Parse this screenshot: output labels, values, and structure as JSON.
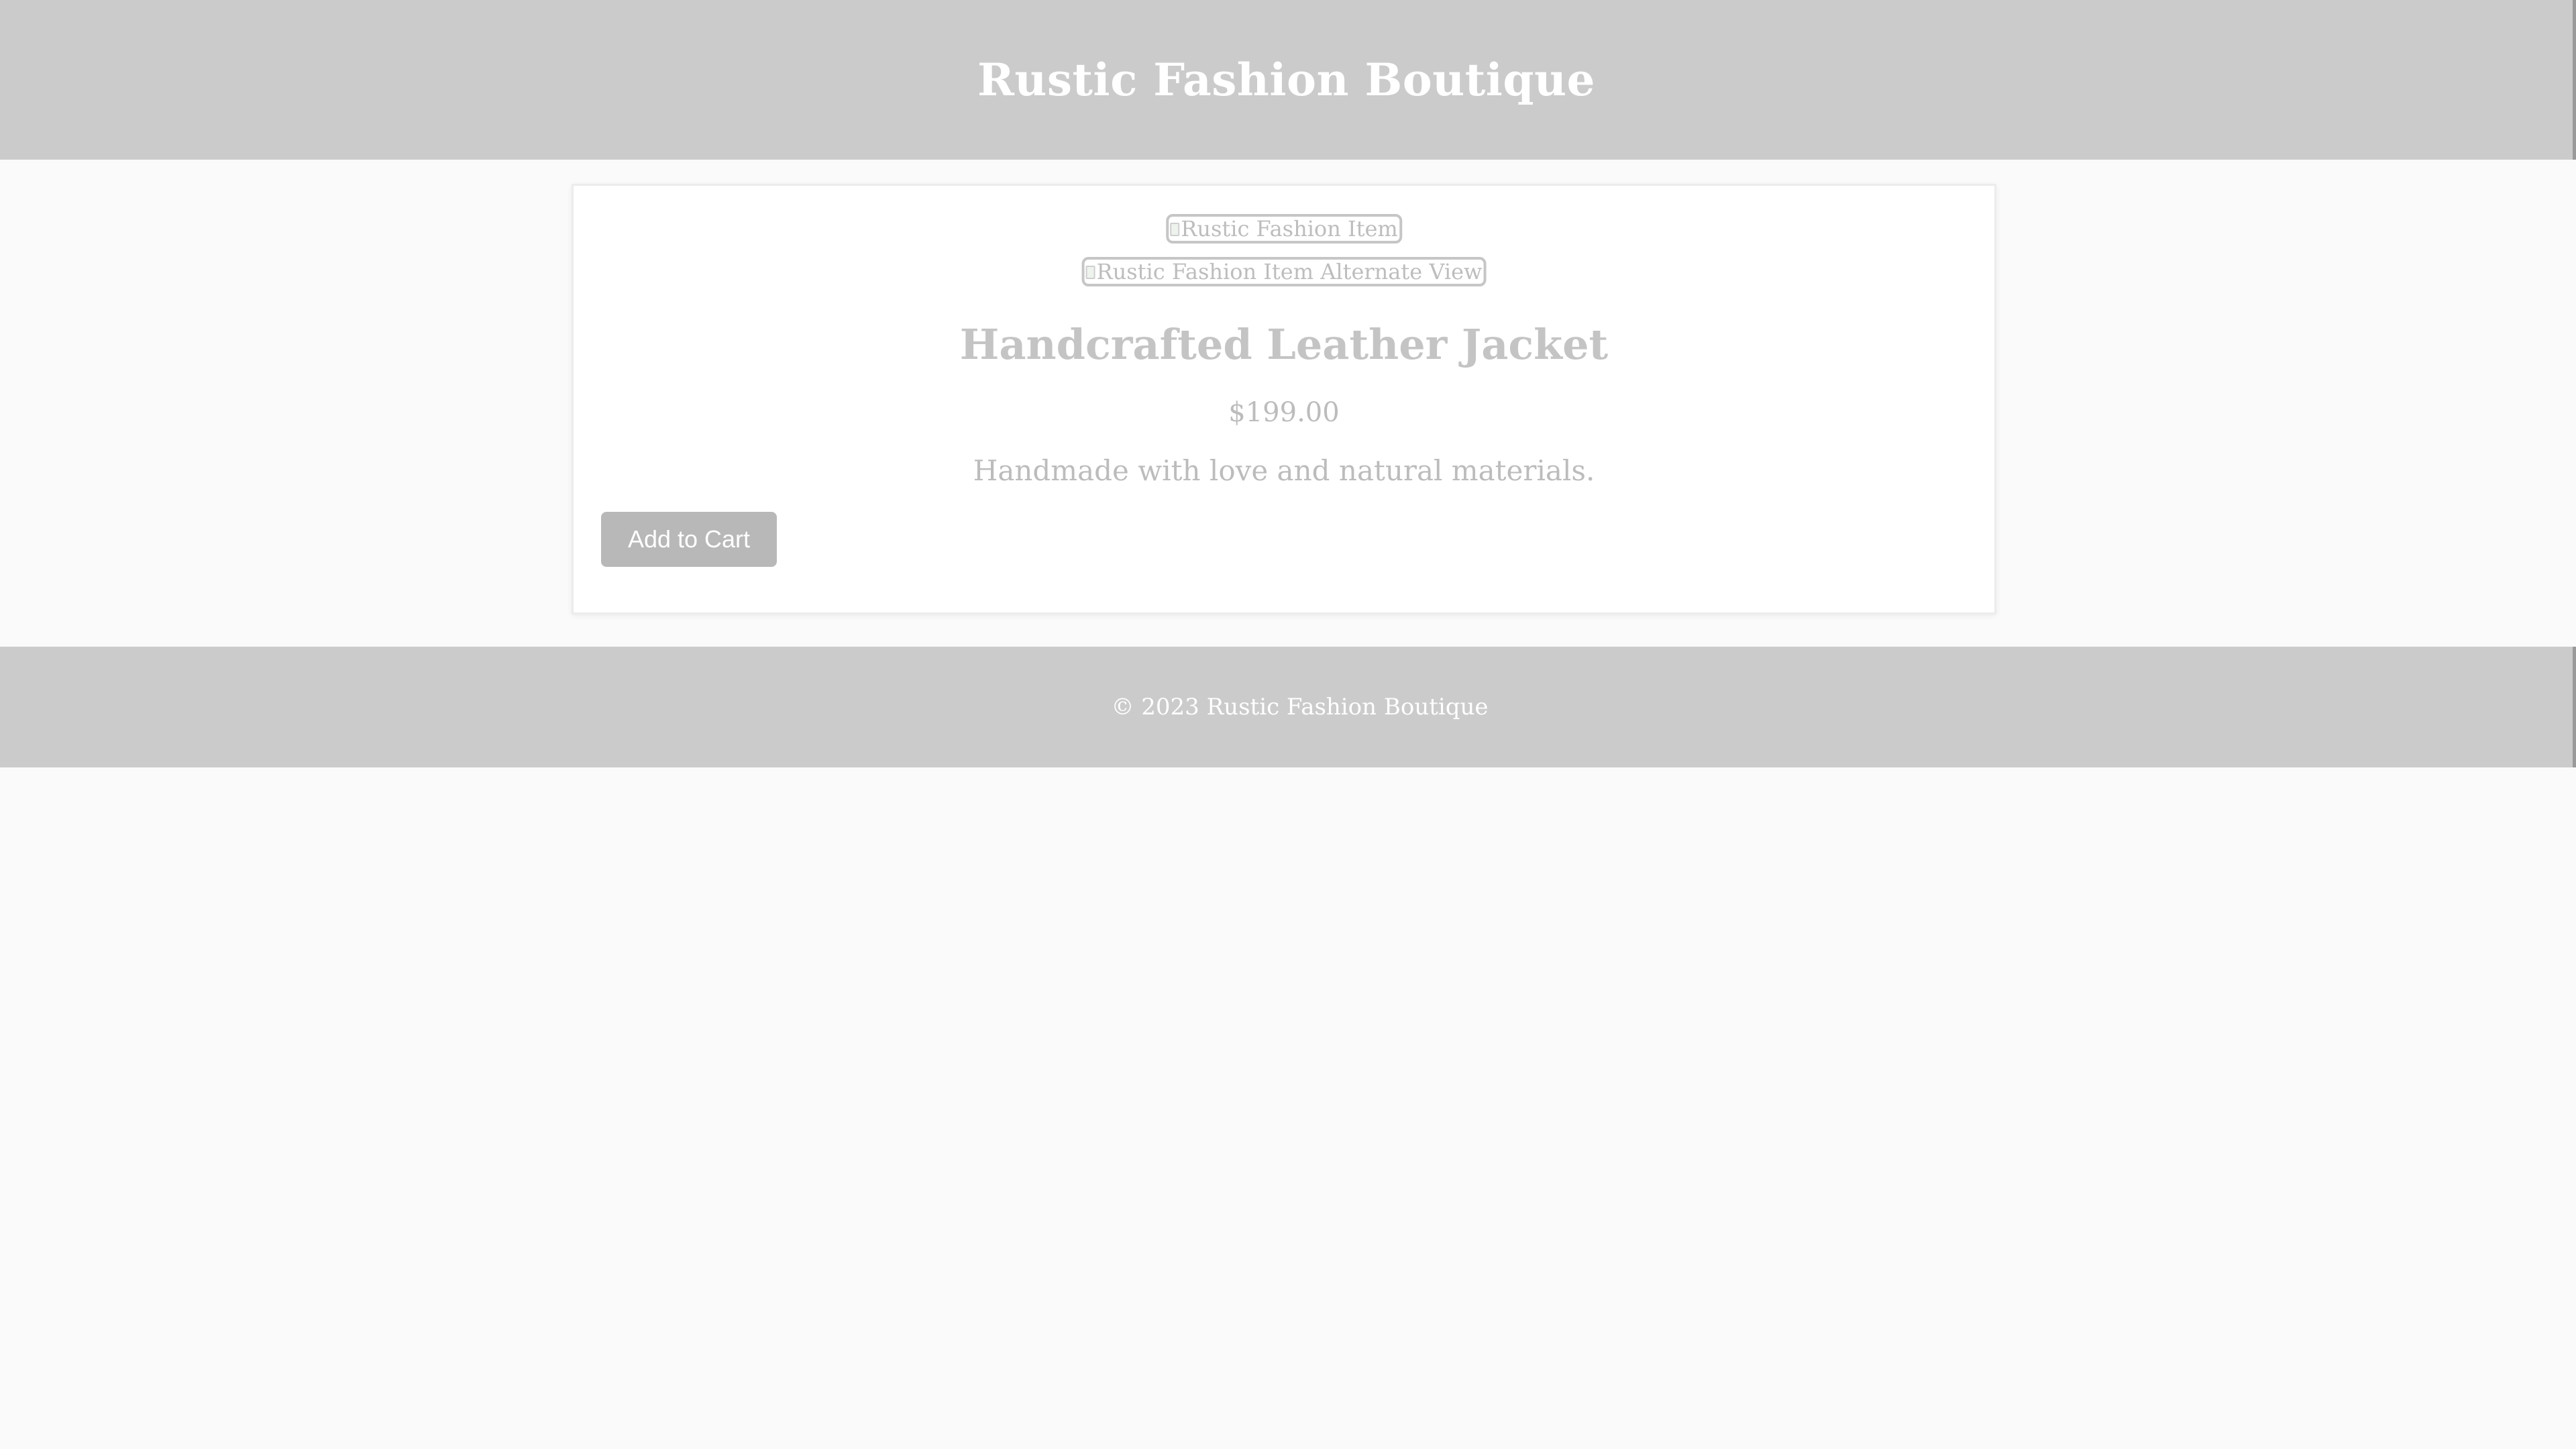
{
  "header": {
    "title": "Rustic Fashion Boutique"
  },
  "product": {
    "images": [
      {
        "alt": "Rustic Fashion Item",
        "icon": "broken-image-icon"
      },
      {
        "alt": "Rustic Fashion Item Alternate View",
        "icon": "broken-image-icon"
      }
    ],
    "title": "Handcrafted Leather Jacket",
    "price": "$199.00",
    "description": "Handmade with love and natural materials.",
    "add_to_cart_label": "Add to Cart"
  },
  "footer": {
    "copyright": "© 2023 Rustic Fashion Boutique"
  },
  "colors": {
    "header_bg": "#cbcbcb",
    "page_bg": "#fafafa",
    "button_bg": "#b8b8b8"
  }
}
